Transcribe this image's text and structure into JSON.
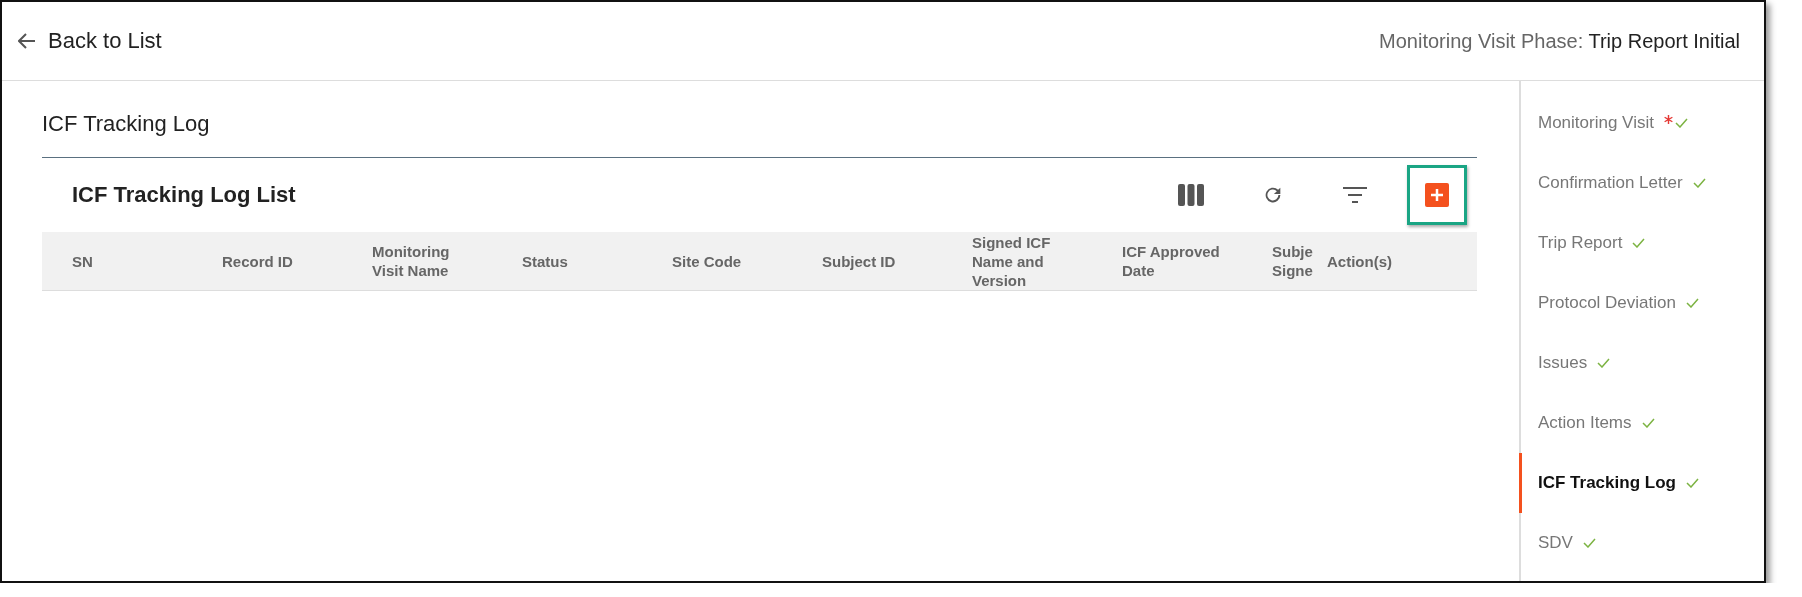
{
  "header": {
    "back_link": "Back to List",
    "phase_label": "Monitoring Visit Phase:",
    "phase_value": "Trip Report Initial"
  },
  "section_title": "ICF Tracking Log",
  "list": {
    "title": "ICF Tracking Log List",
    "toolbar": [
      {
        "kind": "columns"
      },
      {
        "kind": "refresh"
      },
      {
        "kind": "filter"
      },
      {
        "kind": "add",
        "selected": true
      }
    ],
    "columns": [
      "SN",
      "Record ID",
      "Monitoring Visit Name",
      "Status",
      "Site Code",
      "Subject ID",
      "Signed ICF Name and Version",
      "ICF Approved Date",
      "Subje Signe",
      "Action(s)"
    ]
  },
  "sidebar": {
    "items": [
      {
        "label": "Monitoring Visit",
        "required": true,
        "complete": true,
        "selected": false
      },
      {
        "label": "Confirmation Letter",
        "required": false,
        "complete": true,
        "selected": false
      },
      {
        "label": "Trip Report",
        "required": false,
        "complete": true,
        "selected": false
      },
      {
        "label": "Protocol Deviation",
        "required": false,
        "complete": true,
        "selected": false
      },
      {
        "label": "Issues",
        "required": false,
        "complete": true,
        "selected": false
      },
      {
        "label": "Action Items",
        "required": false,
        "complete": true,
        "selected": false
      },
      {
        "label": "ICF Tracking Log",
        "required": false,
        "complete": true,
        "selected": true
      },
      {
        "label": "SDV",
        "required": false,
        "complete": true,
        "selected": false
      }
    ]
  }
}
